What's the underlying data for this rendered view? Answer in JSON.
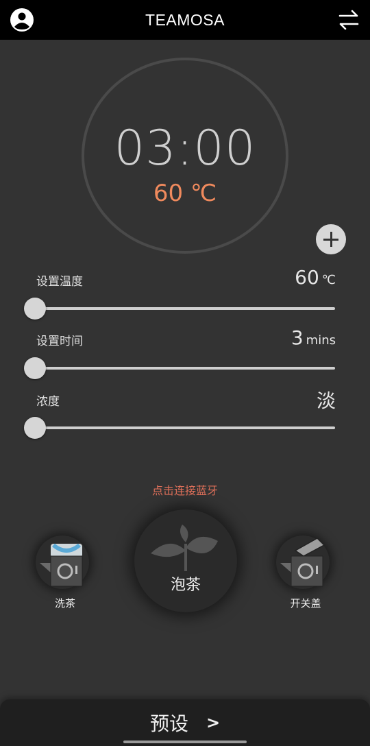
{
  "header": {
    "title": "TEAMOSA",
    "left_icon": "user-icon",
    "right_icon": "swap-icon"
  },
  "dial": {
    "time": "03:00",
    "temperature": "60 ℃",
    "temperature_color": "#f08a5d"
  },
  "settings": [
    {
      "label": "设置温度",
      "value": "60",
      "unit": "℃",
      "slider_fraction": 0.0
    },
    {
      "label": "设置时间",
      "value": "3",
      "unit": "mins",
      "slider_fraction": 0.0
    },
    {
      "label": "浓度",
      "value": "淡",
      "unit": "",
      "slider_fraction": 0.0
    }
  ],
  "bluetooth": {
    "link_text": "点击连接蓝牙",
    "color": "#e0705a"
  },
  "actions": {
    "wash": {
      "label": "洗茶",
      "icon": "teapot-wash-icon"
    },
    "brew": {
      "label": "泡茶",
      "icon": "tea-leaf-icon"
    },
    "lid": {
      "label": "开关盖",
      "icon": "teapot-lid-icon"
    }
  },
  "bottom_bar": {
    "label": "预设",
    "chevron": ">"
  }
}
